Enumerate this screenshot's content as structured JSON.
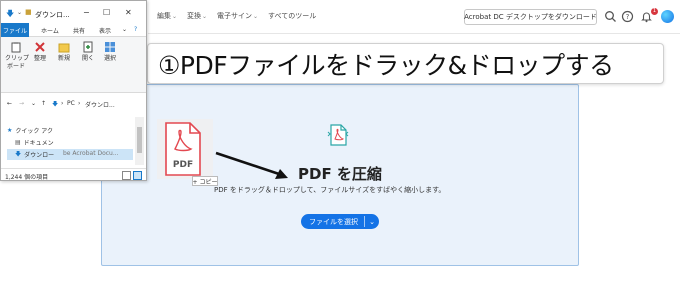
{
  "topnav": {
    "items": [
      {
        "label": "編集",
        "has_menu": true
      },
      {
        "label": "変換",
        "has_menu": true
      },
      {
        "label": "電子サイン",
        "has_menu": true
      },
      {
        "label": "すべてのツール",
        "has_menu": false
      }
    ],
    "download_button": "Acrobat DC デスクトップをダウンロード",
    "notification_count": "1",
    "icons": [
      "search-icon",
      "help-icon",
      "bell-icon",
      "avatar"
    ]
  },
  "annotation": {
    "text": "①PDFファイルをドラック&ドロップする"
  },
  "dropzone": {
    "title": "PDF を圧縮",
    "subtitle": "PDF をドラッグ＆ドロップして、ファイルサイズをすばやく縮小します。",
    "select_button": "ファイルを選択"
  },
  "drag": {
    "file_label": "PDF",
    "tooltip": "+ コピー"
  },
  "explorer": {
    "title": "ダウンロ...",
    "tabs": [
      "ファイル",
      "ホーム",
      "共有",
      "表示"
    ],
    "ribbon": [
      {
        "label": "クリップ\nボード",
        "icon": "clipboard-icon"
      },
      {
        "label": "整理",
        "icon": "organize-icon"
      },
      {
        "label": "新規",
        "icon": "new-folder-icon"
      },
      {
        "label": "開く",
        "icon": "open-icon"
      },
      {
        "label": "選択",
        "icon": "select-icon"
      }
    ],
    "address": [
      "PC",
      "ダウンロ..."
    ],
    "nav_items": [
      {
        "label": "クイック アク",
        "icon": "star-icon"
      },
      {
        "label": "ドキュメン",
        "icon": "document-icon"
      },
      {
        "label": "ダウンロー",
        "icon": "download-icon",
        "selected": true
      }
    ],
    "file_item": "be Acrobat Docu...",
    "status": "1,244 個の項目"
  },
  "colors": {
    "accent": "#1473e6",
    "dropzone_bg": "#eaf2fb",
    "pdf_red": "#e34850",
    "explorer_blue": "#1979ca"
  }
}
